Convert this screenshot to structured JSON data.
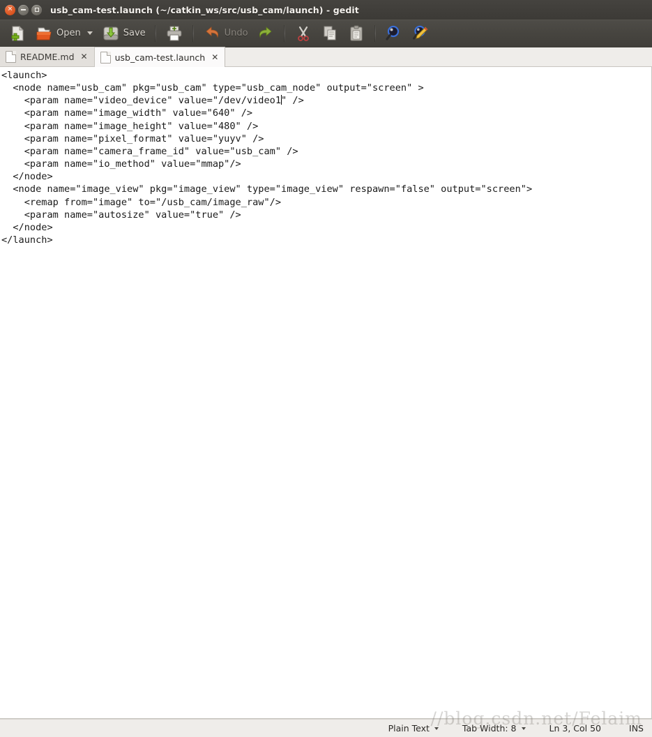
{
  "window": {
    "title": "usb_cam-test.launch (~/catkin_ws/src/usb_cam/launch) - gedit",
    "controls": {
      "close": "close-button",
      "minimize": "minimize-button",
      "maximize": "maximize-button"
    }
  },
  "toolbar": {
    "new_label": "",
    "open_label": "Open",
    "save_label": "Save",
    "print_label": "",
    "undo_label": "Undo",
    "redo_label": "",
    "cut_label": "",
    "copy_label": "",
    "paste_label": "",
    "find_label": "",
    "replace_label": "",
    "icons": {
      "new": "new-document-icon",
      "open": "open-folder-icon",
      "open_dropdown": "chevron-down-icon",
      "save": "save-disk-icon",
      "print": "printer-icon",
      "undo": "undo-arrow-icon",
      "redo": "redo-arrow-icon",
      "cut": "scissors-icon",
      "copy": "copy-pages-icon",
      "paste": "clipboard-icon",
      "find": "magnifier-icon",
      "replace": "magnifier-pencil-icon"
    }
  },
  "tabs": [
    {
      "label": "README.md",
      "active": false,
      "close": "✕"
    },
    {
      "label": "usb_cam-test.launch",
      "active": true,
      "close": "✕"
    }
  ],
  "editor": {
    "line1": "<launch>",
    "line2": "  <node name=\"usb_cam\" pkg=\"usb_cam\" type=\"usb_cam_node\" output=\"screen\" >",
    "line3_before_caret": "    <param name=\"video_device\" value=\"/dev/video1",
    "line3_after_caret": "\" />",
    "line4": "    <param name=\"image_width\" value=\"640\" />",
    "line5": "    <param name=\"image_height\" value=\"480\" />",
    "line6": "    <param name=\"pixel_format\" value=\"yuyv\" />",
    "line7": "    <param name=\"camera_frame_id\" value=\"usb_cam\" />",
    "line8": "    <param name=\"io_method\" value=\"mmap\"/>",
    "line9": "  </node>",
    "line10": "  <node name=\"image_view\" pkg=\"image_view\" type=\"image_view\" respawn=\"false\" output=\"screen\">",
    "line11": "    <remap from=\"image\" to=\"/usb_cam/image_raw\"/>",
    "line12": "    <param name=\"autosize\" value=\"true\" />",
    "line13": "  </node>",
    "line14": "</launch>"
  },
  "statusbar": {
    "language": "Plain Text",
    "tab_width": "Tab Width: 8",
    "position": "Ln 3, Col 50",
    "insert_mode": "INS"
  },
  "watermark": "//blog.csdn.net/Felaim",
  "colors": {
    "titlebar": "#3c3a36",
    "toolbar": "#46443f",
    "tabbar": "#efedea",
    "active_tab": "#fbfafa",
    "inactive_tab": "#e3e0dc",
    "editor_bg": "#ffffff",
    "text": "#1a1a1a",
    "close_button": "#d9531e",
    "accent_orange": "#e06a32",
    "accent_green": "#7bb026"
  }
}
